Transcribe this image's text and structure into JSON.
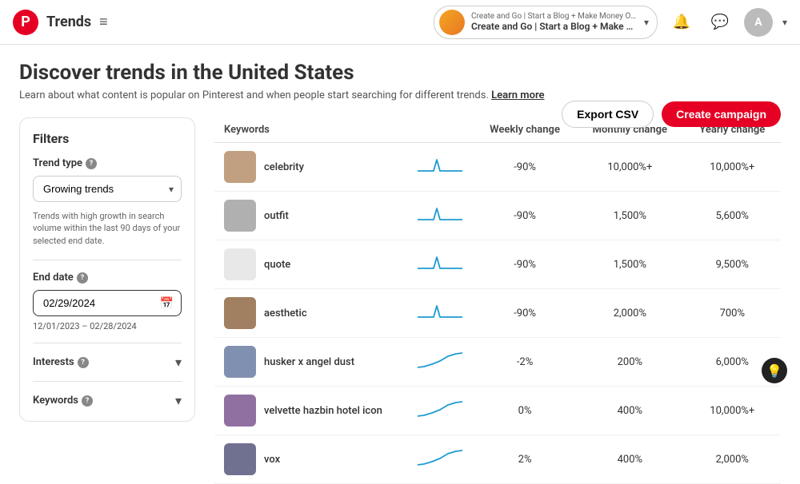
{
  "header": {
    "brand": "Trends",
    "account_top": "Create and Go | Start a Blog + Make Money Online",
    "account_main": "Create and Go | Start a Blog + Make Money Online",
    "chevron": "▾"
  },
  "page": {
    "title": "Discover trends in the United States",
    "subtitle": "Learn about what content is popular on Pinterest and when people start searching for different trends.",
    "learn_more": "Learn more",
    "export_label": "Export CSV",
    "campaign_label": "Create campaign"
  },
  "sidebar": {
    "title": "Filters",
    "trend_type_label": "Trend type",
    "trend_type_value": "Growing trends",
    "trend_type_description": "Trends with high growth in search volume within the last 90 days of your selected end date.",
    "end_date_label": "End date",
    "end_date_value": "02/29/2024",
    "date_range": "12/01/2023 – 02/28/2024",
    "interests_label": "Interests",
    "keywords_label": "Keywords"
  },
  "table": {
    "columns": [
      "Keywords",
      "Weekly change",
      "Monthly change",
      "Yearly change"
    ],
    "rows": [
      {
        "keyword": "celebrity",
        "weekly": "-90%",
        "monthly": "10,000%+",
        "yearly": "10,000%+",
        "thumb_color": "#c0a080",
        "sparkline_type": "spike"
      },
      {
        "keyword": "outfit",
        "weekly": "-90%",
        "monthly": "1,500%",
        "yearly": "5,600%",
        "thumb_color": "#b0b0b0",
        "sparkline_type": "spike"
      },
      {
        "keyword": "quote",
        "weekly": "-90%",
        "monthly": "1,500%",
        "yearly": "9,500%",
        "thumb_color": "#e8e8e8",
        "sparkline_type": "spike"
      },
      {
        "keyword": "aesthetic",
        "weekly": "-90%",
        "monthly": "2,000%",
        "yearly": "700%",
        "thumb_color": "#a08060",
        "sparkline_type": "spike"
      },
      {
        "keyword": "husker x angel dust",
        "weekly": "-2%",
        "monthly": "200%",
        "yearly": "6,000%",
        "thumb_color": "#8090b0",
        "sparkline_type": "rise"
      },
      {
        "keyword": "velvette hazbin hotel icon",
        "weekly": "0%",
        "monthly": "400%",
        "yearly": "10,000%+",
        "thumb_color": "#9070a0",
        "sparkline_type": "rise"
      },
      {
        "keyword": "vox",
        "weekly": "2%",
        "monthly": "400%",
        "yearly": "2,000%",
        "thumb_color": "#707090",
        "sparkline_type": "rise"
      }
    ]
  },
  "icons": {
    "pinterest_p": "P",
    "hamburger": "≡",
    "bell": "🔔",
    "chat": "💬",
    "calendar": "📅",
    "lightbulb": "💡"
  }
}
